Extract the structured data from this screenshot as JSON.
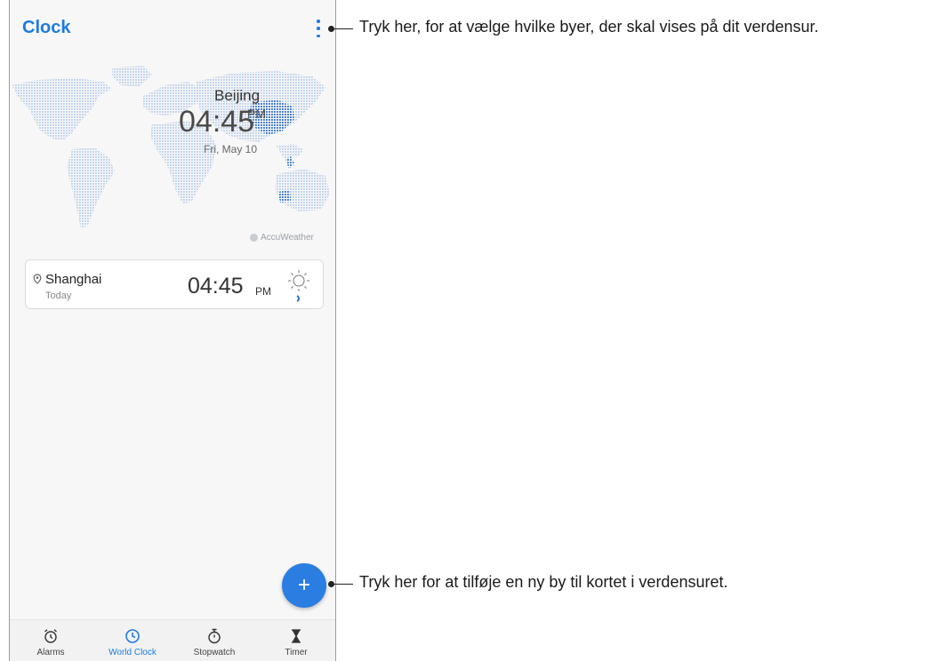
{
  "app": {
    "title": "Clock"
  },
  "featured": {
    "city": "Beijing",
    "time": "04:45",
    "ampm": "PM",
    "date": "Fri, May 10"
  },
  "attribution": "AccuWeather",
  "cities": [
    {
      "name": "Shanghai",
      "day": "Today",
      "time": "04:45",
      "ampm": "PM"
    }
  ],
  "fab": {
    "label": "+"
  },
  "nav": {
    "items": [
      {
        "label": "Alarms",
        "icon": "alarm-icon"
      },
      {
        "label": "World Clock",
        "icon": "world-clock-icon"
      },
      {
        "label": "Stopwatch",
        "icon": "stopwatch-icon"
      },
      {
        "label": "Timer",
        "icon": "hourglass-icon"
      }
    ],
    "active": "World Clock"
  },
  "annotations": {
    "menu": "Tryk her, for at vælge hvilke byer, der skal vises på dit verdensur.",
    "add": "Tryk her for at tilføje en ny by til kortet i verdensuret."
  },
  "colors": {
    "accent": "#1e7be0",
    "fab": "#2a7de1",
    "map": "#b9cde8",
    "map_highlight": "#2e6fc7"
  }
}
